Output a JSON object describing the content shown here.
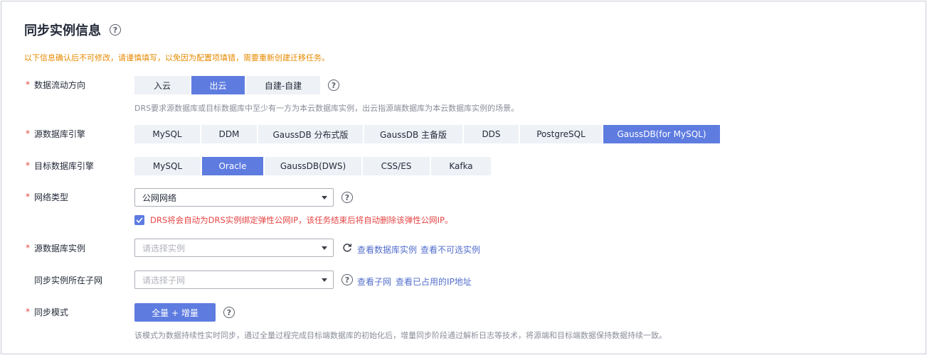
{
  "page": {
    "title": "同步实例信息",
    "help_icon": "?",
    "warning": "以下信息确认后不可修改，请谨慎填写，以免因为配置项填错，需要重新创建迁移任务。"
  },
  "required_mark": "*",
  "direction": {
    "label": "数据流动方向",
    "options": [
      "入云",
      "出云",
      "自建-自建"
    ],
    "selected": "出云",
    "hint": "DRS要求源数据库或目标数据库中至少有一方为本云数据库实例，出云指源端数据库为本云数据库实例的场景。"
  },
  "source_engine": {
    "label": "源数据库引擎",
    "options": [
      "MySQL",
      "DDM",
      "GaussDB 分布式版",
      "GaussDB 主备版",
      "DDS",
      "PostgreSQL",
      "GaussDB(for MySQL)"
    ],
    "selected": "GaussDB(for MySQL)"
  },
  "target_engine": {
    "label": "目标数据库引擎",
    "options": [
      "MySQL",
      "Oracle",
      "GaussDB(DWS)",
      "CSS/ES",
      "Kafka"
    ],
    "selected": "Oracle"
  },
  "network": {
    "label": "网络类型",
    "value": "公网网络",
    "checkbox_checked": true,
    "checkbox_text": "DRS将会自动为DRS实例绑定弹性公网IP，该任务结束后将自动删除该弹性公网IP。"
  },
  "source_instance": {
    "label": "源数据库实例",
    "placeholder": "请选择实例",
    "link_view": "查看数据库实例",
    "link_unselectable": "查看不可选实例"
  },
  "subnet": {
    "label": "同步实例所在子网",
    "placeholder": "请选择子网",
    "link_view": "查看子网",
    "link_used_ip": "查看已占用的IP地址"
  },
  "sync_mode": {
    "label": "同步模式",
    "button": "全量 + 增量",
    "hint": "该模式为数据持续性实时同步，通过全量过程完成目标端数据库的初始化后，增量同步阶段通过解析日志等技术，将源端和目标端数据保持数据持续一致。"
  },
  "colors": {
    "accent": "#5e7ce0",
    "link": "#526ecc",
    "warning": "#e68a00",
    "error": "#e54545",
    "segment_bg": "#eef1f6"
  }
}
